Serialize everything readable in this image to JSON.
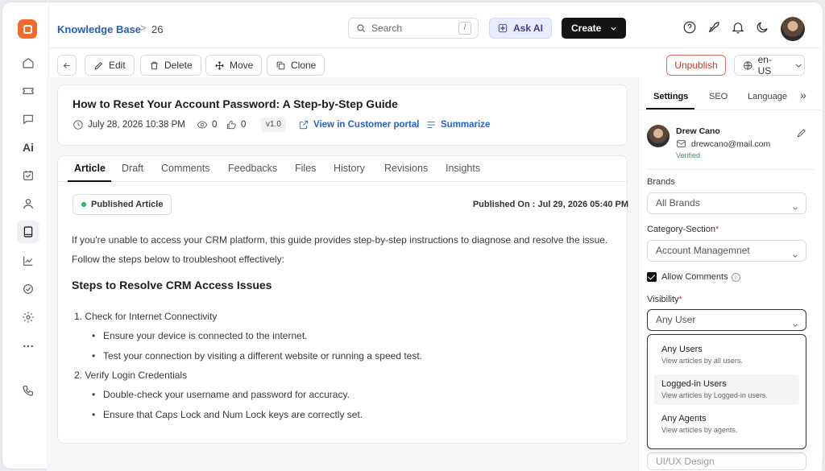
{
  "header": {
    "breadcrumb_root": "Knowledge Base",
    "breadcrumb_sep": ">",
    "breadcrumb_id": "26",
    "search_placeholder": "Search",
    "search_shortcut": "/",
    "ask_ai_label": "Ask AI",
    "create_label": "Create"
  },
  "toolbar": {
    "edit_label": "Edit",
    "delete_label": "Delete",
    "move_label": "Move",
    "clone_label": "Clone",
    "unpublish_label": "Unpublish",
    "language": "en-US"
  },
  "article": {
    "title": "How to Reset Your Account Password: A Step-by-Step Guide",
    "date": "July 28, 2026 10:38 PM",
    "views": "0",
    "likes": "0",
    "version": "v1.0",
    "view_portal_label": "View in Customer portal",
    "summarize_label": "Summarize",
    "status": "Published Article",
    "published_on": "Published On : Jul 29, 2026 05:40 PM",
    "intro": "If you're unable to access your CRM platform, this guide provides step-by-step instructions to diagnose and resolve the issue. Follow the steps below to troubleshoot effectively:",
    "heading": "Steps to Resolve CRM Access Issues",
    "steps": [
      {
        "title": "1. Check for Internet Connectivity",
        "bullets": [
          "Ensure your device is connected to the internet.",
          "Test your connection by visiting a different website or running a speed test."
        ]
      },
      {
        "title": "2. Verify Login Credentials",
        "bullets": [
          "Double-check your username and password for accuracy.",
          "Ensure that Caps Lock and Num Lock keys are correctly set."
        ]
      }
    ]
  },
  "tabs": [
    "Article",
    "Draft",
    "Comments",
    "Feedbacks",
    "Files",
    "History",
    "Revisions",
    "Insights"
  ],
  "right_panel": {
    "tabs": [
      "Settings",
      "SEO",
      "Language"
    ],
    "more": "»",
    "author_name": "Drew Cano",
    "author_email": "drewcano@mail.com",
    "verified": "Verified",
    "brands_label": "Brands",
    "brands_value": "All Brands",
    "category_label": "Category-Section",
    "category_value": "Account Managemnet",
    "required_mark": "*",
    "allow_comments_label": "Allow Comments",
    "visibility_label": "Visibility",
    "visibility_value": "Any User",
    "options": [
      {
        "title": "Any Users",
        "desc": "View articles by all users."
      },
      {
        "title": "Logged-in Users",
        "desc": "View articles by Logged-in users."
      },
      {
        "title": "Any Agents",
        "desc": "View articles by agents."
      }
    ],
    "below_field": "UI/UX Design"
  },
  "colors": {
    "brand": "#f26b2e",
    "link": "#2563c9",
    "danger": "#c9332f",
    "verified": "#2a9d5f"
  }
}
